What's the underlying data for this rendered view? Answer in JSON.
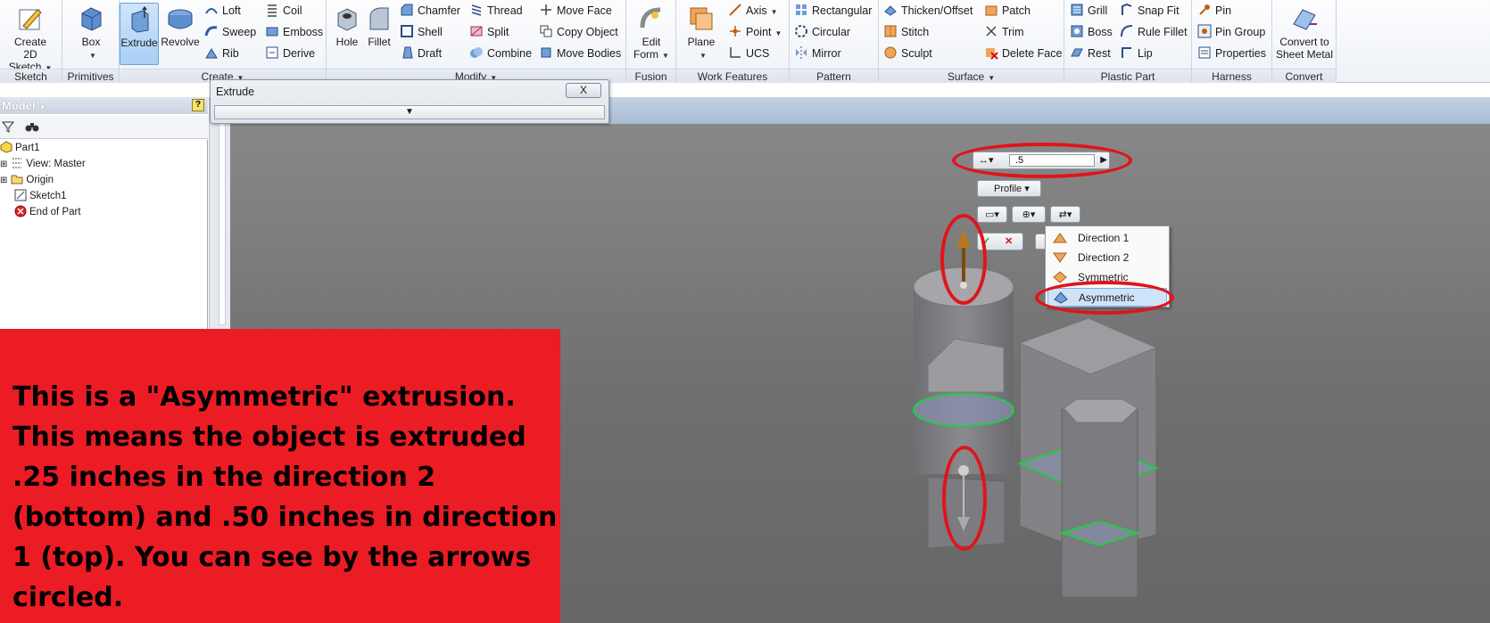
{
  "ribbon": {
    "sketch": {
      "label": "Sketch",
      "create_sketch": "Create\n2D Sketch"
    },
    "primitives": {
      "label": "Primitives",
      "box": "Box"
    },
    "create": {
      "label": "Create",
      "extrude": "Extrude",
      "revolve": "Revolve",
      "col1": [
        "Loft",
        "Sweep",
        "Rib"
      ],
      "col2": [
        "Coil",
        "Emboss",
        "Derive"
      ]
    },
    "modify": {
      "label": "Modify",
      "hole": "Hole",
      "fillet": "Fillet",
      "col1": [
        "Chamfer",
        "Shell",
        "Draft"
      ],
      "col2": [
        "Thread",
        "Split",
        "Combine"
      ],
      "col3": [
        "Move Face",
        "Copy Object",
        "Move Bodies"
      ]
    },
    "fusion": {
      "label": "Fusion",
      "edit_form": "Edit\nForm"
    },
    "work_features": {
      "label": "Work Features",
      "plane": "Plane",
      "col1": [
        "Axis",
        "Point",
        "UCS"
      ]
    },
    "pattern": {
      "label": "Pattern",
      "col1": [
        "Rectangular",
        "Circular",
        "Mirror"
      ]
    },
    "surface": {
      "label": "Surface",
      "col1": [
        "Thicken/Offset",
        "Stitch",
        "Sculpt"
      ],
      "col2": [
        "Patch",
        "Trim",
        "Delete Face"
      ]
    },
    "plastic_part": {
      "label": "Plastic Part",
      "col1": [
        "Grill",
        "Boss",
        "Rest"
      ],
      "col2": [
        "Snap Fit",
        "Rule Fillet",
        "Lip"
      ]
    },
    "harness": {
      "label": "Harness",
      "col1": [
        "Pin",
        "Pin Group",
        "Properties"
      ]
    },
    "convert": {
      "label": "Convert",
      "convert_sheet_metal": "Convert to\nSheet Metal"
    }
  },
  "model_panel": {
    "title": "Model",
    "tree": [
      "Part1",
      "View: Master",
      "Origin",
      "Sketch1",
      "End of Part"
    ]
  },
  "extrude_dialog": {
    "title": "Extrude",
    "close": "X"
  },
  "minitoolbar": {
    "distance_value": ".5",
    "profile": "Profile",
    "direction_menu": [
      "Direction 1",
      "Direction 2",
      "Symmetric",
      "Asymmetric"
    ]
  },
  "callout": {
    "text": "This is a \"Asymmetric\" extrusion. This means the object is extruded .25 inches in the direction 2 (bottom) and .50 inches in direction 1 (top). You can see by the arrows circled."
  },
  "colors": {
    "accent_red": "#ec1c24",
    "ring_red": "#e0141b",
    "selected_blue": "#a9d0f5"
  }
}
